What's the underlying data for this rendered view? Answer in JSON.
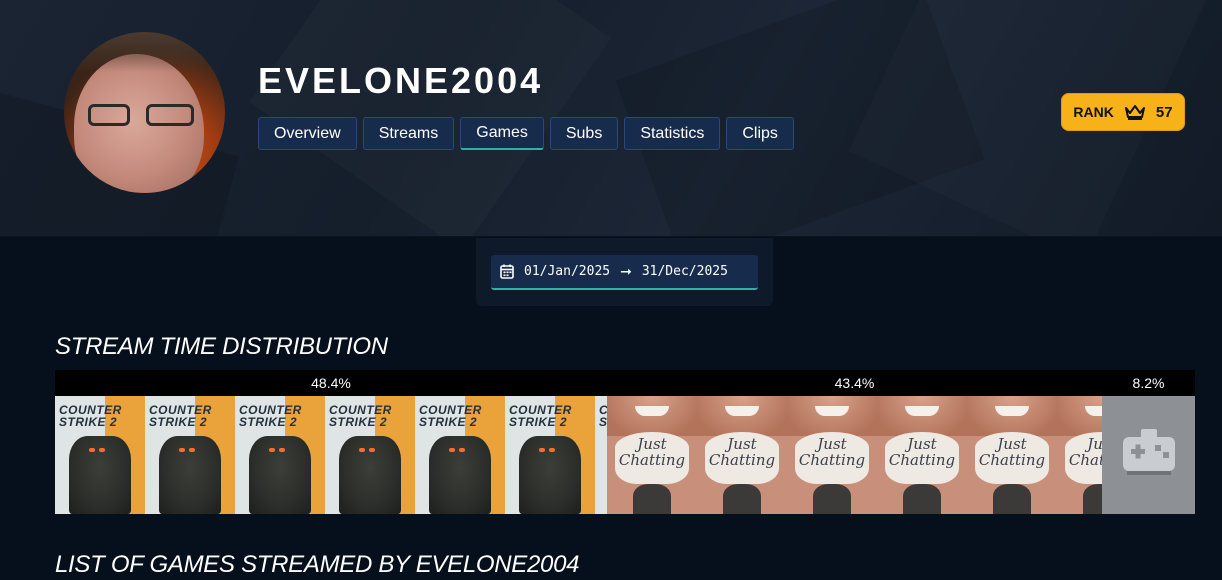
{
  "profile": {
    "username": "EVELONE2004",
    "tabs": [
      {
        "label": "Overview",
        "active": false
      },
      {
        "label": "Streams",
        "active": false
      },
      {
        "label": "Games",
        "active": true
      },
      {
        "label": "Subs",
        "active": false
      },
      {
        "label": "Statistics",
        "active": false
      },
      {
        "label": "Clips",
        "active": false
      }
    ],
    "rank": {
      "label": "RANK",
      "value": "57",
      "icon": "crown-icon",
      "color": "#f7b21a"
    }
  },
  "date_range": {
    "icon": "calendar-icon",
    "start": "01/Jan/2025",
    "arrow": "➞",
    "end": "31/Dec/2025"
  },
  "sections": {
    "distribution_title": "STREAM TIME DISTRIBUTION",
    "list_title": "LIST OF GAMES STREAMED BY EVELONE2004"
  },
  "distribution": [
    {
      "game": "Counter-Strike 2",
      "percent": 48.4,
      "label": "48.4%",
      "art": "counter-strike-2-cover",
      "logo_text": "COUNTER STRIKE 2"
    },
    {
      "game": "Just Chatting",
      "percent": 43.4,
      "label": "43.4%",
      "art": "just-chatting-cover",
      "logo_text": "Just Chatting"
    },
    {
      "game": "Other",
      "percent": 8.2,
      "label": "8.2%",
      "art": "gamepad-icon"
    }
  ],
  "colors": {
    "accent": "#2bb3a6",
    "tab_bg": "#172c4c",
    "page_bg": "#060f1c"
  }
}
